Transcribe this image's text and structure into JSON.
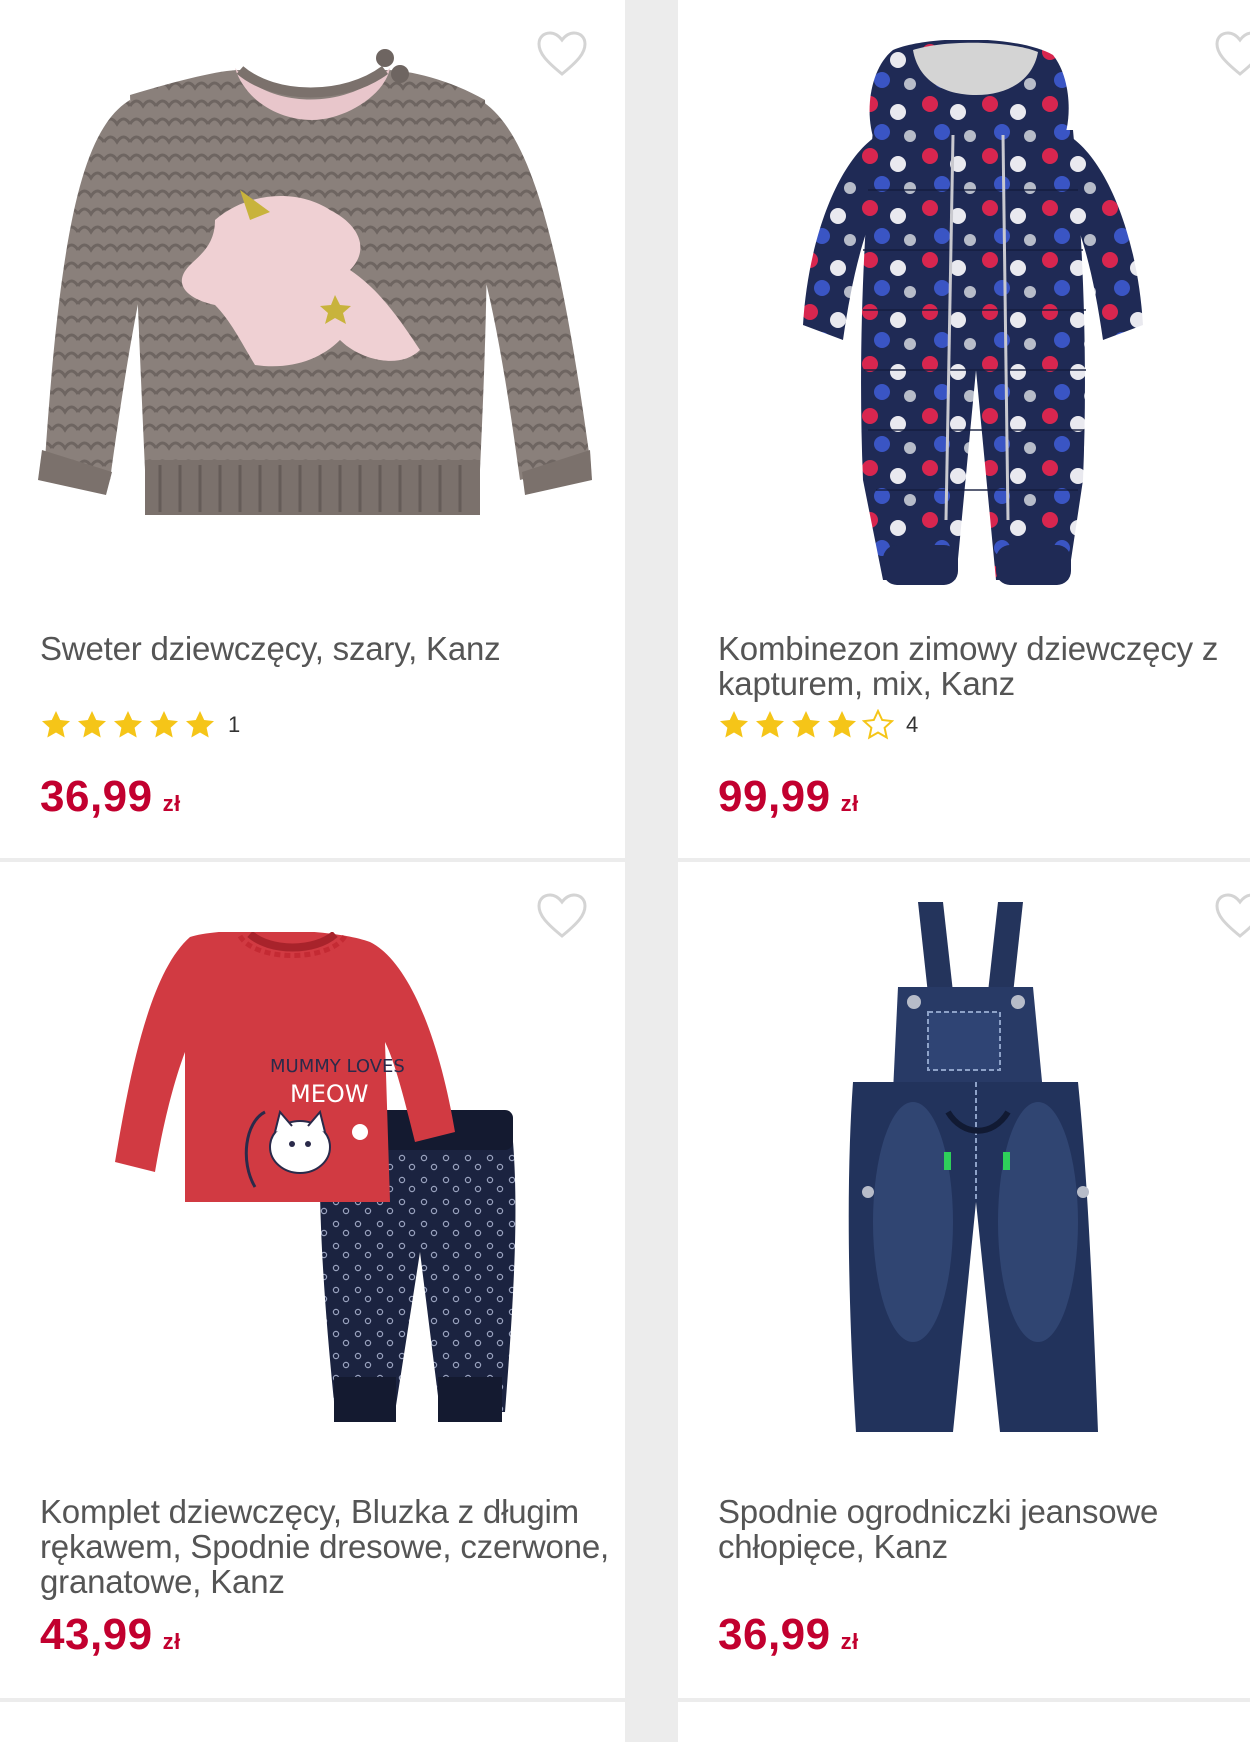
{
  "accent_color": "#c2002f",
  "star_color": "#f5c518",
  "products": [
    {
      "title": "Sweter dziewczęcy, szary, Kanz",
      "rating": 5,
      "review_count": "1",
      "price": "36,99",
      "currency": "zł",
      "favorite_icon": "heart-outline-icon"
    },
    {
      "title": "Kombinezon zimowy dziewczęcy z kapturem, mix, Kanz",
      "rating": 4,
      "review_count": "4",
      "price": "99,99",
      "currency": "zł",
      "favorite_icon": "heart-outline-icon"
    },
    {
      "title": "Komplet dziewczęcy, Bluzka z długim rękawem, Spodnie dresowe, czerwone, granatowe, Kanz",
      "rating": null,
      "review_count": "",
      "price": "43,99",
      "currency": "zł",
      "favorite_icon": "heart-outline-icon"
    },
    {
      "title": "Spodnie ogrodniczki jeansowe chłopięce, Kanz",
      "rating": null,
      "review_count": "",
      "price": "36,99",
      "currency": "zł",
      "favorite_icon": "heart-outline-icon"
    }
  ]
}
